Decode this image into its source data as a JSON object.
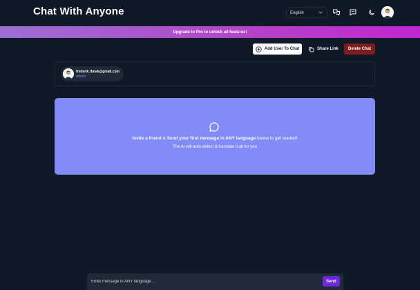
{
  "header": {
    "title": "Chat With Anyone",
    "language": "English",
    "icons": [
      "chat-bubbles-icon",
      "message-icon",
      "moon-icon"
    ]
  },
  "banner": {
    "text": "Upgrade to Pro to unlock all features!"
  },
  "actions": {
    "add_user": "Add User To Chat",
    "share_link": "Share Link",
    "delete_chat": "Delete Chat"
  },
  "users": [
    {
      "email": "frederik.rbnsk@gmail.com",
      "role": "Admin"
    }
  ],
  "empty_state": {
    "invite_bold1": "Invite a friend",
    "amp": " & ",
    "invite_bold2": "Send your first message in ANY language",
    "invite_rest": " below to get started!",
    "auto_detect": "The AI will auto-detect & translate it all for you"
  },
  "composer": {
    "placeholder": "Enter message in ANY language...",
    "send_label": "Send"
  },
  "colors": {
    "background": "#111827",
    "banner_start": "#9b6fd3",
    "banner_end": "#c026d3",
    "card": "#818cf8",
    "delete": "#7f1d1d",
    "send": "#6d28d9"
  }
}
